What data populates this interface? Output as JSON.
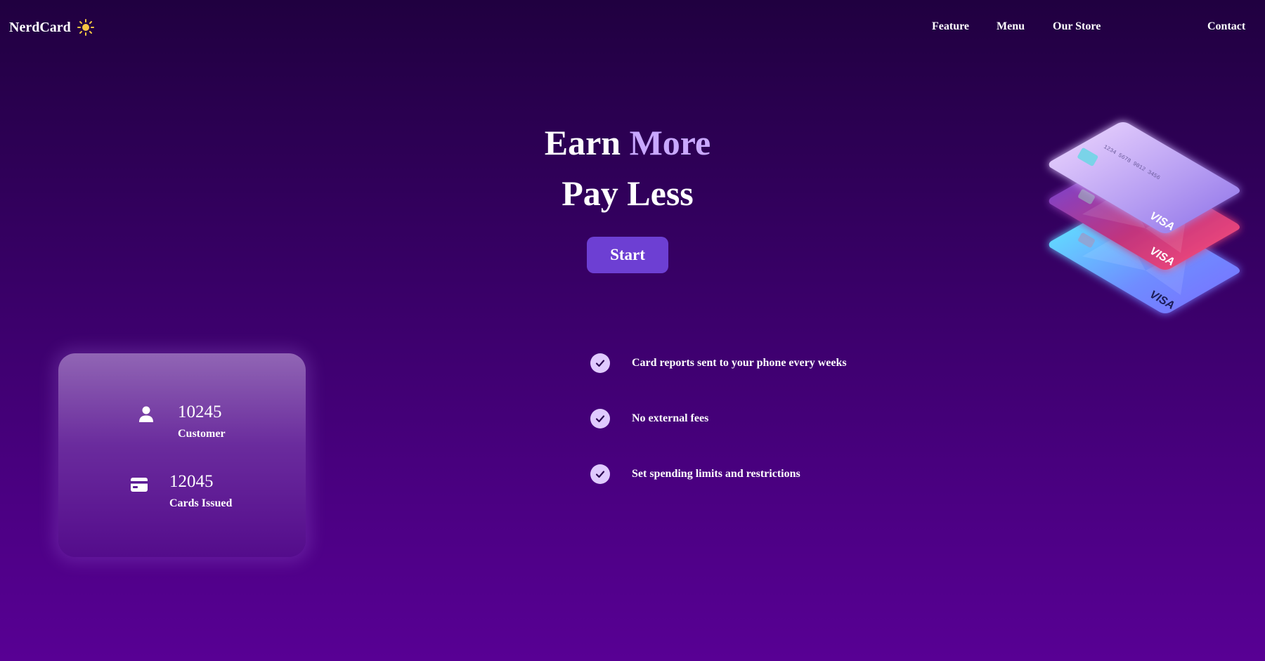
{
  "brand": {
    "name": "NerdCard",
    "icon": "sun-icon",
    "icon_color": "#f5c542"
  },
  "nav": {
    "links": [
      {
        "label": "Feature"
      },
      {
        "label": "Menu"
      },
      {
        "label": "Our Store"
      },
      {
        "label": "Contact"
      }
    ]
  },
  "hero": {
    "line1_word1": "Earn",
    "line1_word2": "More",
    "line2": "Pay Less",
    "cta_label": "Start",
    "accent_color": "#c9a8ff",
    "cta_color": "#6d3fd3"
  },
  "stats": [
    {
      "icon": "user-icon",
      "value": "10245",
      "label": "Customer"
    },
    {
      "icon": "credit-card-icon",
      "value": "12045",
      "label": "Cards Issued"
    }
  ],
  "features": [
    {
      "icon": "check-icon",
      "text": "Card reports sent to your phone every weeks"
    },
    {
      "icon": "check-icon",
      "text": "No external fees"
    },
    {
      "icon": "check-icon",
      "text": "Set spending limits and restrictions"
    }
  ],
  "card_illustration": {
    "top_card_number": "1234 5678 9012 3456",
    "card_brand": "VISA",
    "colors": [
      "#c3a8ff",
      "#e0457b",
      "#5ee6ff"
    ]
  }
}
